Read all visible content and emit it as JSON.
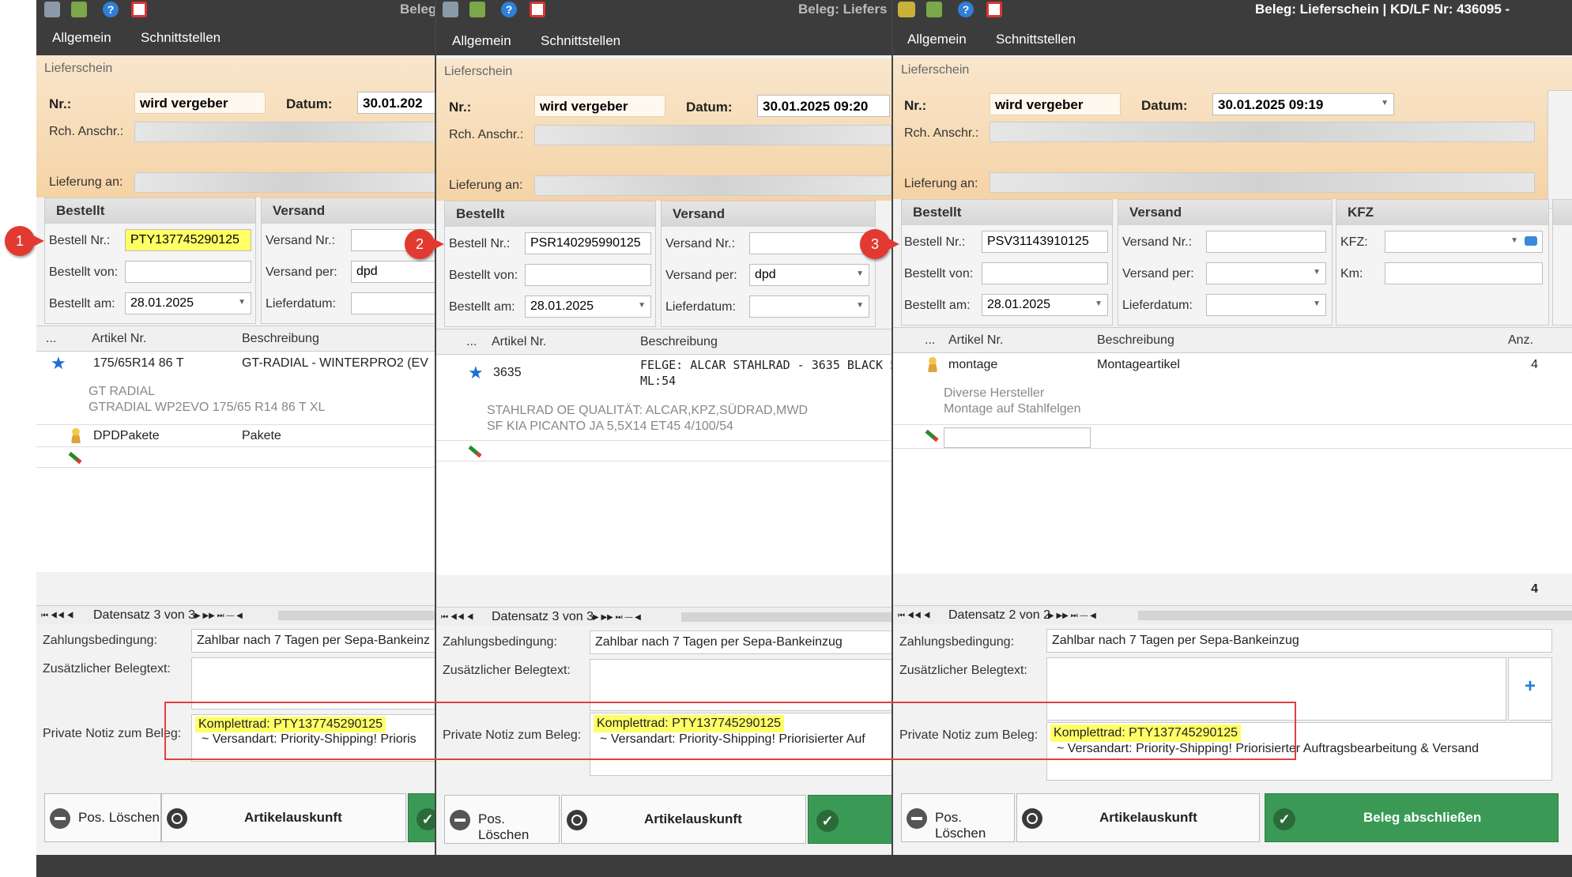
{
  "menu": {
    "allgemein": "Allgemein",
    "schnittstellen": "Schnittstellen"
  },
  "titles": {
    "p1": "Beleg",
    "p2": "Beleg: Liefers",
    "p3": "Beleg: Lieferschein |  KD/LF Nr: 436095 -"
  },
  "labels": {
    "section": "Lieferschein",
    "nr": "Nr.:",
    "datum": "Datum:",
    "rch": "Rch. Anschr.:",
    "lieferung": "Lieferung an:",
    "bestellt": "Bestellt",
    "versand": "Versand",
    "kfz_group": "KFZ",
    "bestell_nr": "Bestell Nr.:",
    "bestellt_von": "Bestellt von:",
    "bestellt_am": "Bestellt am:",
    "versand_nr": "Versand Nr.:",
    "versand_per": "Versand per:",
    "lieferdatum": "Lieferdatum:",
    "kfz": "KFZ:",
    "km": "Km:",
    "col_dots": "...",
    "col_artikel": "Artikel Nr.",
    "col_beschreibung": "Beschreibung",
    "col_anz": "Anz.",
    "zahlung": "Zahlungsbedingung:",
    "zusatz": "Zusätzlicher Belegtext:",
    "notiz": "Private Notiz zum Beleg:",
    "btn_loeschen": "Pos. Löschen",
    "btn_artikel": "Artikelauskunft",
    "btn_abschliessen": "Beleg abschließen"
  },
  "panels": [
    {
      "badge": "1",
      "nr": "wird vergeber",
      "datum": "30.01.202",
      "bestell_nr": "PTY137745290125",
      "bestellt_am": "28.01.2025",
      "versand_per": "dpd",
      "rows": [
        {
          "artikel": "175/65R14 86 T",
          "beschreibung": "GT-RADIAL - WINTERPRO2 (EV",
          "sub1": "GT RADIAL",
          "sub2": "GTRADIAL WP2EVO 175/65 R14 86 T XL"
        },
        {
          "artikel": "DPDPakete",
          "beschreibung": "Pakete"
        }
      ],
      "datensatz": "Datensatz 3 von 3",
      "zahlung": "Zahlbar nach 7 Tagen per Sepa-Bankeinz",
      "notiz1": "Komplettrad: PTY137745290125",
      "notiz2": "~ Versandart: Priority-Shipping!   Prioris"
    },
    {
      "badge": "2",
      "nr": "wird vergeber",
      "datum": "30.01.2025 09:20",
      "bestell_nr": "PSR140295990125",
      "bestellt_am": "28.01.2025",
      "versand_per": "dpd",
      "rows": [
        {
          "artikel": "3635",
          "beschreibung": "FELGE: ALCAR STAHLRAD - 3635 BLACK 5",
          "beschreibung2": "ML:54",
          "sub1": "STAHLRAD OE QUALITÄT: ALCAR,KPZ,SÜDRAD,MWD",
          "sub2": "SF KIA PICANTO JA 5,5X14 ET45 4/100/54"
        }
      ],
      "datensatz": "Datensatz 3 von 3",
      "zahlung": "Zahlbar nach 7 Tagen per Sepa-Bankeinzug",
      "notiz1": "Komplettrad: PTY137745290125",
      "notiz2": "~ Versandart: Priority-Shipping!   Priorisierter Auf"
    },
    {
      "badge": "3",
      "nr": "wird vergeber",
      "datum": "30.01.2025 09:19",
      "bestell_nr": "PSV31143910125",
      "bestellt_am": "28.01.2025",
      "rows": [
        {
          "artikel": "montage",
          "beschreibung": "Montageartikel",
          "anz": "4",
          "sub1": "Diverse Hersteller",
          "sub2": "Montage auf Stahlfelgen"
        }
      ],
      "sum": "4",
      "datensatz": "Datensatz 2 von 2",
      "zahlung": "Zahlbar nach 7 Tagen per Sepa-Bankeinzug",
      "notiz1": "Komplettrad: PTY137745290125",
      "notiz2": "~ Versandart: Priority-Shipping!   Priorisierter Auftragsbearbeitung & Versand"
    }
  ]
}
